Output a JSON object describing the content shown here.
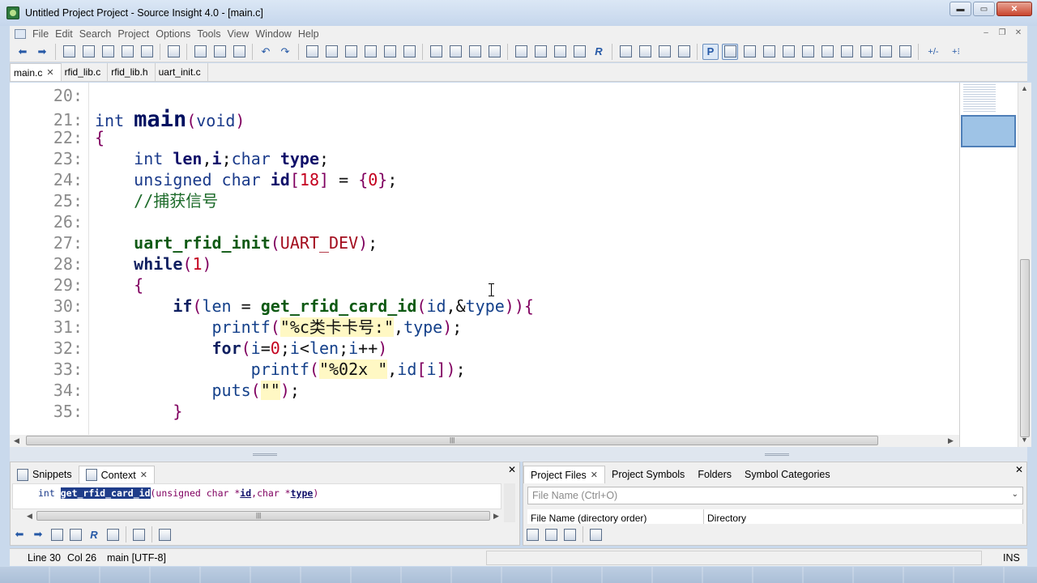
{
  "window": {
    "title": "Untitled Project Project - Source Insight 4.0 - [main.c]",
    "controls": {
      "minimize": "▬",
      "maximize": "▭",
      "close": "✕"
    }
  },
  "menu": {
    "items": [
      "File",
      "Edit",
      "Search",
      "Project",
      "Options",
      "Tools",
      "View",
      "Window",
      "Help"
    ],
    "mdi": {
      "minimize": "–",
      "restore": "❐",
      "close": "✕"
    }
  },
  "toolbar": {
    "icons": [
      "back-arrow-icon",
      "forward-arrow-icon",
      "new-file-icon",
      "open-icon",
      "save-icon",
      "save-all-icon",
      "close-file-icon",
      "print-icon",
      "cut-icon",
      "copy-icon",
      "paste-icon",
      "undo-icon",
      "redo-icon",
      "search-icon",
      "jump-up-icon",
      "jump-down-icon",
      "replace-icon",
      "swap-icon",
      "web-icon",
      "bookmark-prev-icon",
      "bookmark-next-icon",
      "goto-icon",
      "star-icon",
      "lookup-icon",
      "reference-icon",
      "book-icon",
      "call-icon",
      "r-icon",
      "layout-1-icon",
      "layout-2-icon",
      "layout-3-icon",
      "layout-4-icon",
      "p-icon",
      "relation-icon",
      "tree-icon",
      "doc-icon",
      "graph-icon",
      "link-icon",
      "sync-icon",
      "home-icon",
      "bird-icon",
      "split-icon",
      "list-icon",
      "plus-minus-icon",
      "plus-menu-icon"
    ],
    "glyphs": {
      "back": "⬅",
      "forward": "➡",
      "undo": "↶",
      "redo": "↷",
      "r": "R",
      "p": "P",
      "plus_minus": "+/-",
      "plus_menu": "+⁝"
    }
  },
  "tabs": [
    {
      "label": "main.c",
      "active": true,
      "close": "✕"
    },
    {
      "label": "rfid_lib.c",
      "active": false
    },
    {
      "label": "rfid_lib.h",
      "active": false
    },
    {
      "label": "uart_init.c",
      "active": false
    }
  ],
  "editor": {
    "lines": [
      {
        "n": "20:",
        "code": ""
      },
      {
        "n": "21:",
        "code": "int main(void)"
      },
      {
        "n": "22:",
        "code": "{"
      },
      {
        "n": "23:",
        "code": "    int len,i;char type;"
      },
      {
        "n": "24:",
        "code": "    unsigned char id[18] = {0};"
      },
      {
        "n": "25:",
        "code": "    //捕获信号"
      },
      {
        "n": "26:",
        "code": ""
      },
      {
        "n": "27:",
        "code": "    uart_rfid_init(UART_DEV);"
      },
      {
        "n": "28:",
        "code": "    while(1)"
      },
      {
        "n": "29:",
        "code": "    {"
      },
      {
        "n": "30:",
        "code": "        if(len = get_rfid_card_id(id,&type)){"
      },
      {
        "n": "31:",
        "code": "            printf(\"%c类卡卡号:\",type);"
      },
      {
        "n": "32:",
        "code": "            for(i=0;i<len;i++)"
      },
      {
        "n": "33:",
        "code": "                printf(\"%02x \",id[i]);"
      },
      {
        "n": "34:",
        "code": "            puts(\"\");"
      },
      {
        "n": "35:",
        "code": "        }"
      }
    ]
  },
  "scroll": {
    "up": "▲",
    "down": "▼",
    "left": "◀",
    "right": "▶",
    "grip": "|||"
  },
  "context_panel": {
    "tabs": [
      {
        "label": "Snippets",
        "active": false
      },
      {
        "label": "Context",
        "active": true,
        "close": "✕"
      }
    ],
    "close": "✕",
    "signature": {
      "type": "int",
      "name": "get_rfid_card_id",
      "open": "(unsigned char *",
      "p1": "id",
      "mid": ",char *",
      "p2": "type",
      "close": ")"
    }
  },
  "project_panel": {
    "tabs": [
      {
        "label": "Project Files",
        "active": true,
        "close": "✕"
      },
      {
        "label": "Project Symbols",
        "active": false
      },
      {
        "label": "Folders",
        "active": false
      },
      {
        "label": "Symbol Categories",
        "active": false
      }
    ],
    "close": "✕",
    "file_name_placeholder": "File Name (Ctrl+O)",
    "dropdown_arrow": "⌄",
    "columns": [
      "File Name (directory order)",
      "Directory"
    ]
  },
  "status": {
    "line": "Line 30",
    "col": "Col 26",
    "symbol": "main [UTF-8]",
    "mode": "INS"
  }
}
